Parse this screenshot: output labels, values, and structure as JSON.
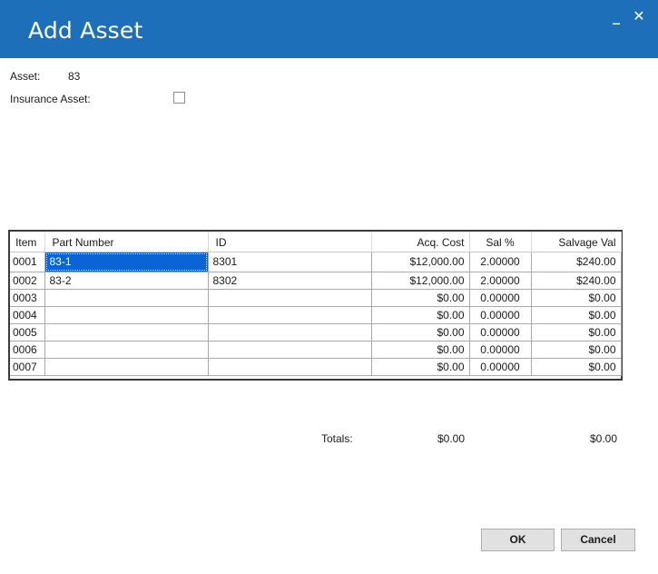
{
  "window": {
    "title": "Add Asset",
    "minimize_glyph": "_",
    "close_glyph": "✕"
  },
  "form": {
    "asset_label": "Asset:",
    "asset_value": "83",
    "insurance_label": "Insurance Asset:",
    "insurance_checked": false
  },
  "grid": {
    "columns": [
      "Item",
      "Part Number",
      "ID",
      "Acq. Cost",
      "Sal %",
      "Salvage Val"
    ],
    "rows": [
      {
        "item": "0001",
        "part": "83-1",
        "id": "8301",
        "cost": "$12,000.00",
        "sal": "2.00000",
        "salvage": "$240.00"
      },
      {
        "item": "0002",
        "part": "83-2",
        "id": "8302",
        "cost": "$12,000.00",
        "sal": "2.00000",
        "salvage": "$240.00"
      },
      {
        "item": "0003",
        "part": "",
        "id": "",
        "cost": "$0.00",
        "sal": "0.00000",
        "salvage": "$0.00"
      },
      {
        "item": "0004",
        "part": "",
        "id": "",
        "cost": "$0.00",
        "sal": "0.00000",
        "salvage": "$0.00"
      },
      {
        "item": "0005",
        "part": "",
        "id": "",
        "cost": "$0.00",
        "sal": "0.00000",
        "salvage": "$0.00"
      },
      {
        "item": "0006",
        "part": "",
        "id": "",
        "cost": "$0.00",
        "sal": "0.00000",
        "salvage": "$0.00"
      },
      {
        "item": "0007",
        "part": "",
        "id": "",
        "cost": "$0.00",
        "sal": "0.00000",
        "salvage": "$0.00"
      }
    ]
  },
  "totals": {
    "label": "Totals:",
    "acq_cost": "$0.00",
    "salvage_val": "$0.00"
  },
  "buttons": {
    "ok": "OK",
    "cancel": "Cancel"
  },
  "colors": {
    "titlebar": "#1e6fba",
    "selection": "#0a64d6"
  }
}
